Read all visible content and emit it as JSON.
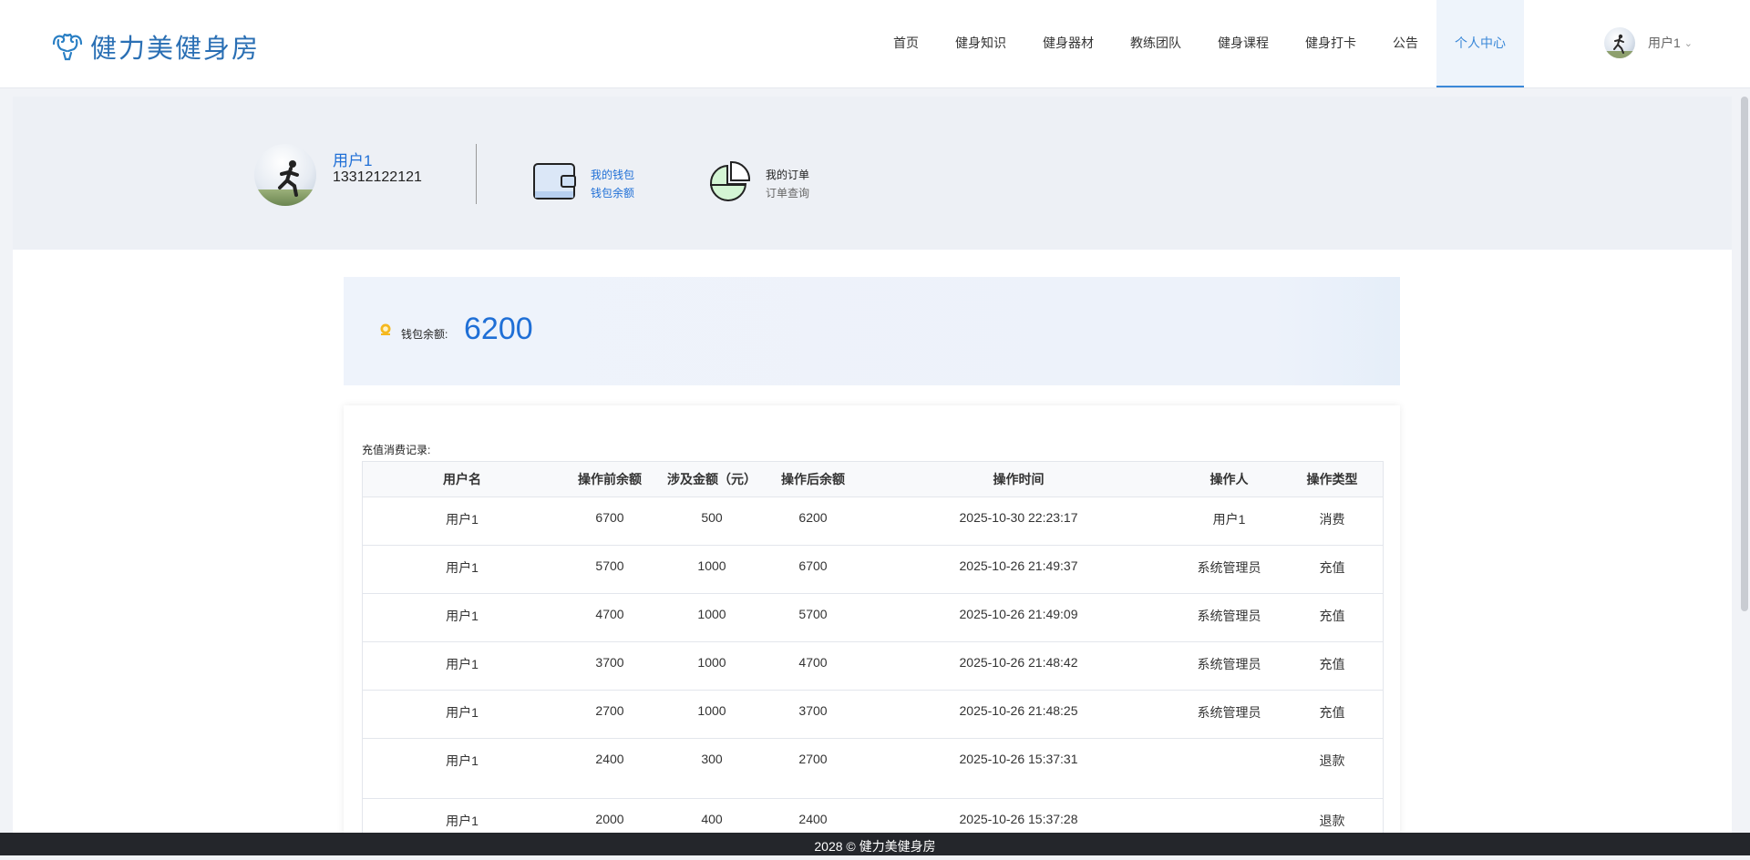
{
  "brand": {
    "name": "健力美健身房"
  },
  "nav": {
    "items": [
      {
        "label": "首页"
      },
      {
        "label": "健身知识"
      },
      {
        "label": "健身器材"
      },
      {
        "label": "教练团队"
      },
      {
        "label": "健身课程"
      },
      {
        "label": "健身打卡"
      },
      {
        "label": "公告"
      },
      {
        "label": "个人中心",
        "active": true
      }
    ]
  },
  "user_menu": {
    "name": "用户1"
  },
  "profile": {
    "name": "用户1",
    "phone": "13312122121",
    "wallet": {
      "line1": "我的钱包",
      "line2": "钱包余额"
    },
    "orders": {
      "line1": "我的订单",
      "line2": "订单查询"
    }
  },
  "balance": {
    "label": "钱包余额:",
    "value": "6200"
  },
  "records": {
    "title": "充值消费记录:",
    "columns": [
      "用户名",
      "操作前余额",
      "涉及金额（元）",
      "操作后余额",
      "操作时间",
      "操作人",
      "操作类型"
    ],
    "rows": [
      [
        "用户1",
        "6700",
        "500",
        "6200",
        "2025-10-30 22:23:17",
        "用户1",
        "消费"
      ],
      [
        "用户1",
        "5700",
        "1000",
        "6700",
        "2025-10-26 21:49:37",
        "系统管理员",
        "充值"
      ],
      [
        "用户1",
        "4700",
        "1000",
        "5700",
        "2025-10-26 21:49:09",
        "系统管理员",
        "充值"
      ],
      [
        "用户1",
        "3700",
        "1000",
        "4700",
        "2025-10-26 21:48:42",
        "系统管理员",
        "充值"
      ],
      [
        "用户1",
        "2700",
        "1000",
        "3700",
        "2025-10-26 21:48:25",
        "系统管理员",
        "充值"
      ],
      [
        "用户1",
        "2400",
        "300",
        "2700",
        "2025-10-26 15:37:31",
        "",
        "退款"
      ],
      [
        "用户1",
        "2000",
        "400",
        "2400",
        "2025-10-26 15:37:28",
        "",
        "退款"
      ]
    ]
  },
  "footer": {
    "text": "2028 © 健力美健身房"
  },
  "colors": {
    "accent": "#1f6fd6",
    "nav_active": "#3a88d8",
    "footer_bg": "#24262b"
  }
}
